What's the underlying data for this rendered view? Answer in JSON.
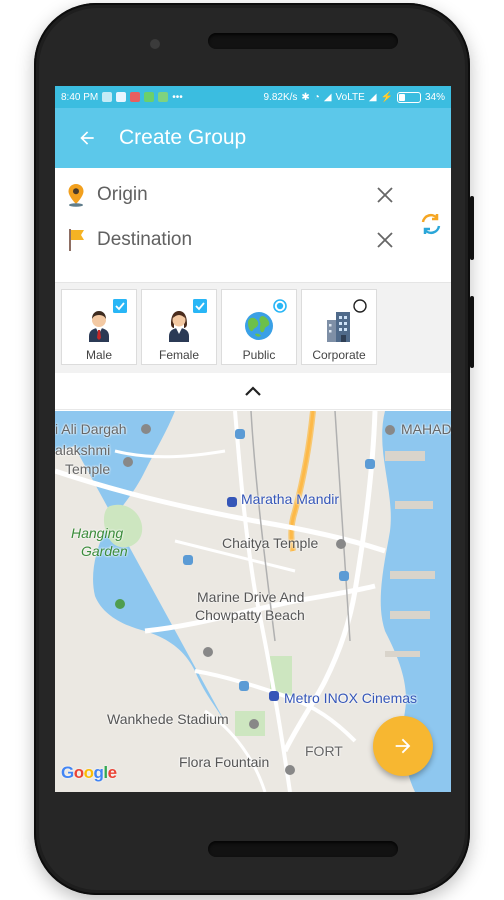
{
  "status_bar": {
    "time": "8:40 PM",
    "speed": "9.82K/s",
    "network": "VoLTE",
    "battery": "34%",
    "battery_level": 0.34
  },
  "app_bar": {
    "title": "Create Group",
    "back_icon": "arrow-back-icon"
  },
  "route": {
    "origin_placeholder": "Origin",
    "destination_placeholder": "Destination"
  },
  "categories": [
    {
      "label": "Male",
      "selected": true,
      "selector": "checkbox"
    },
    {
      "label": "Female",
      "selected": true,
      "selector": "checkbox"
    },
    {
      "label": "Public",
      "selected": true,
      "selector": "radio"
    },
    {
      "label": "Corporate",
      "selected": false,
      "selector": "radio"
    }
  ],
  "map": {
    "labels": [
      "i Ali Dargah",
      "alakshmi",
      "Temple",
      "MAHAD",
      "Maratha Mandir",
      "Hanging",
      "Garden",
      "Chaitya Temple",
      "Marine Drive And",
      "Chowpatty Beach",
      "Metro INOX Cinemas",
      "Wankhede Stadium",
      "FORT",
      "Flora Fountain"
    ],
    "google_logo": "Google"
  },
  "colors": {
    "status_bar": "#3bbde0",
    "app_bar": "#5cc8ea",
    "fab": "#f7b731",
    "checkbox": "#29b6f6",
    "swap_orange": "#f5a623",
    "swap_blue": "#2aa6d8"
  }
}
